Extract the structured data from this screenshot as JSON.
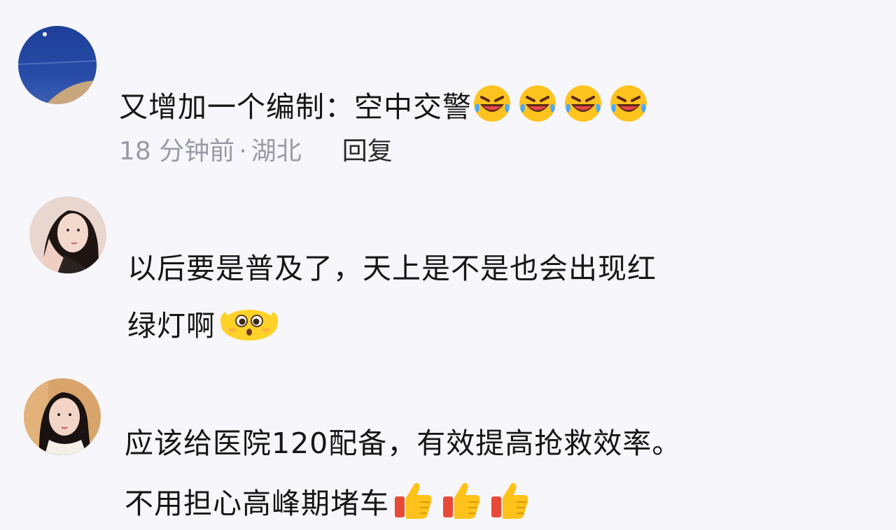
{
  "comments": [
    {
      "lines": [
        "又增加一个编制：空中交警"
      ],
      "trailing_emojis": [
        "rolling-laughing-emoji",
        "rolling-laughing-emoji",
        "rolling-laughing-emoji",
        "rolling-laughing-emoji"
      ],
      "meta": {
        "time": "18 分钟前",
        "separator": "·",
        "location": "湖北",
        "reply": "回复"
      }
    },
    {
      "lines": [
        "以后要是普及了，天上是不是也会出现红",
        "绿灯啊"
      ],
      "trailing_emojis": [
        "pleading-face-emoji"
      ]
    },
    {
      "lines": [
        "应该给医院120配备，有效提高抢救效率。",
        "不用担心高峰期堵车"
      ],
      "trailing_emojis": [
        "thumbs-up-emoji",
        "thumbs-up-emoji",
        "thumbs-up-emoji"
      ]
    }
  ],
  "colors": {
    "background": "#f6f6fb",
    "meta_text": "#9a9aa6",
    "reply_text": "#2a2a2a",
    "body_text": "#161616"
  }
}
